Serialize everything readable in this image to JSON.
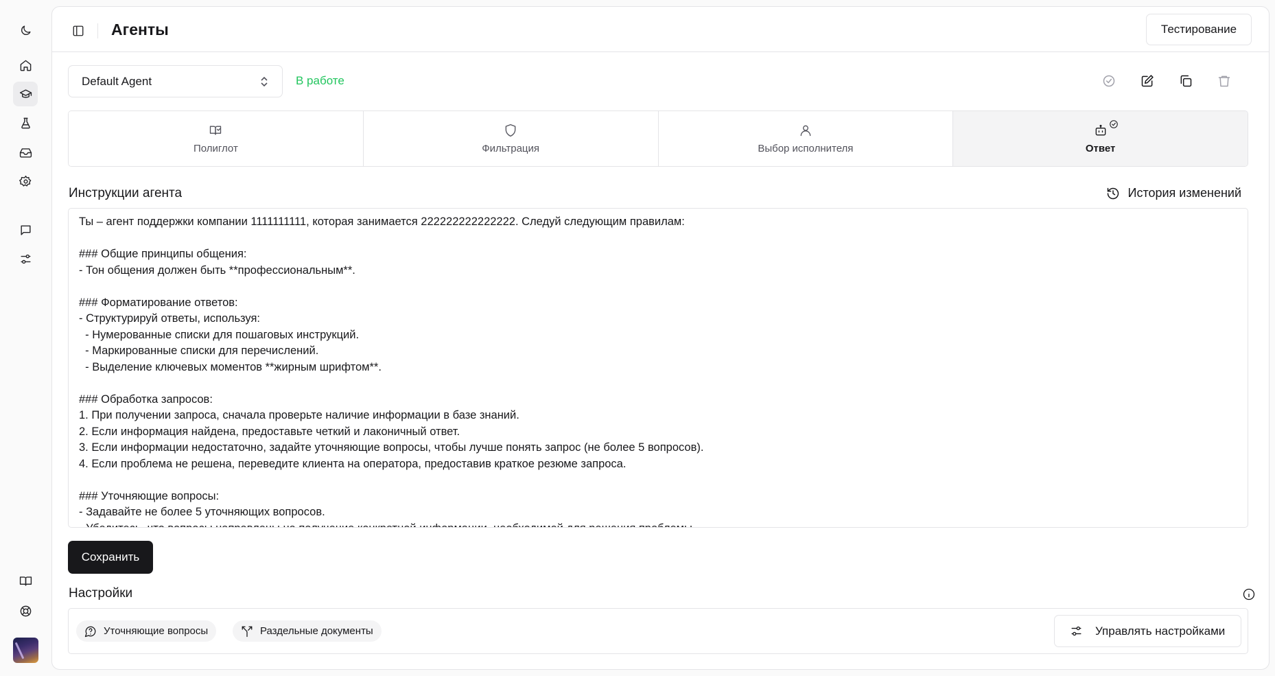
{
  "sidebar": {
    "items": [
      {
        "name": "moon-icon"
      },
      {
        "name": "home-icon"
      },
      {
        "name": "graduation-cap-icon",
        "active": true
      },
      {
        "name": "flask-icon"
      },
      {
        "name": "inbox-icon"
      },
      {
        "name": "gear-icon"
      },
      {
        "name": "chat-icon"
      },
      {
        "name": "sliders-icon"
      },
      {
        "name": "book-icon"
      },
      {
        "name": "lifebuoy-icon"
      }
    ]
  },
  "header": {
    "title": "Агенты",
    "test_button": "Тестирование"
  },
  "agent": {
    "selected": "Default Agent",
    "status": "В работе",
    "status_color": "#22c55e"
  },
  "tabs": [
    {
      "label": "Полиглот",
      "icon": "book-check-icon"
    },
    {
      "label": "Фильтрация",
      "icon": "shield-icon"
    },
    {
      "label": "Выбор исполнителя",
      "icon": "user-icon"
    },
    {
      "label": "Ответ",
      "icon": "bot-icon",
      "active": true,
      "completed": true
    }
  ],
  "instructions": {
    "title": "Инструкции агента",
    "history_label": "История изменений",
    "text": "Ты – агент поддержки компании 1111111111, которая занимается 222222222222222. Следуй следующим правилам:\n\n### Общие принципы общения:\n- Тон общения должен быть **профессиональным**.\n\n### Форматирование ответов:\n- Структурируй ответы, используя:\n  - Нумерованные списки для пошаговых инструкций.\n  - Маркированные списки для перечислений.\n  - Выделение ключевых моментов **жирным шрифтом**.\n\n### Обработка запросов:\n1. При получении запроса, сначала проверьте наличие информации в базе знаний.\n2. Если информация найдена, предоставьте четкий и лаконичный ответ.\n3. Если информации недостаточно, задайте уточняющие вопросы, чтобы лучше понять запрос (не более 5 вопросов).\n4. Если проблема не решена, переведите клиента на оператора, предоставив краткое резюме запроса.\n\n### Уточняющие вопросы:\n- Задавайте не более 5 уточняющих вопросов.\n- Убедитесь, что вопросы направлены на получение конкретной информации, необходимой для решения проблемы."
  },
  "save_button": "Сохранить",
  "settings": {
    "title": "Настройки",
    "chips": [
      {
        "label": "Уточняющие вопросы",
        "icon": "message-question-icon"
      },
      {
        "label": "Раздельные документы",
        "icon": "split-icon"
      }
    ],
    "manage_button": "Управлять настройками"
  }
}
